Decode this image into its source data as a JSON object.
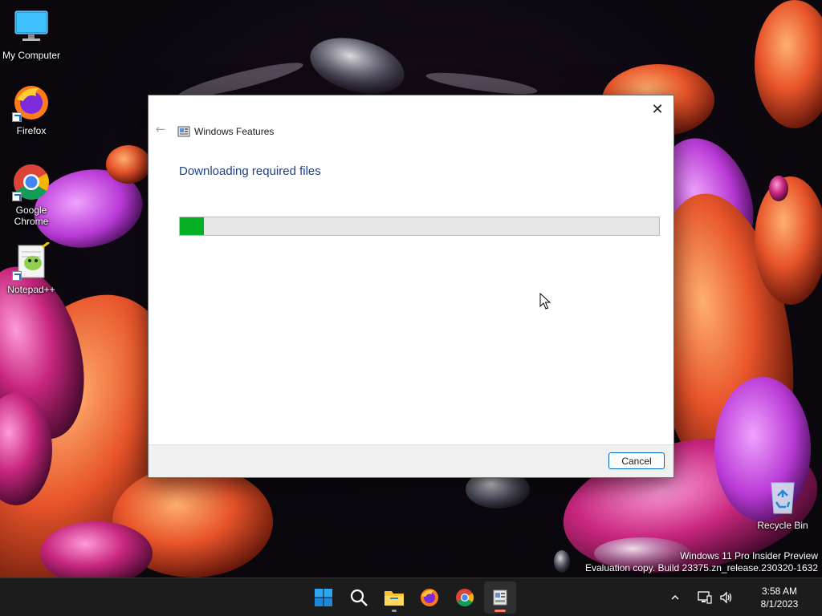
{
  "desktop": {
    "icons": [
      {
        "label": "My Computer",
        "icon": "monitor-icon"
      },
      {
        "label": "Firefox",
        "icon": "firefox-icon"
      },
      {
        "label": "Google Chrome",
        "icon": "chrome-icon"
      },
      {
        "label": "Notepad++",
        "icon": "notepadpp-icon"
      },
      {
        "label": "Recycle Bin",
        "icon": "recycle-bin-icon"
      }
    ],
    "watermark": {
      "line1": "Windows 11 Pro Insider Preview",
      "line2": "Evaluation copy. Build 23375.zn_release.230320-1632"
    }
  },
  "dialog": {
    "title": "Windows Features",
    "heading": "Downloading required files",
    "progress_percent": 5,
    "cancel_label": "Cancel",
    "close_glyph": "✕",
    "back_glyph": "←"
  },
  "taskbar": {
    "apps": [
      "start-icon",
      "search-icon",
      "file-explorer-icon",
      "firefox-icon",
      "chrome-icon",
      "windows-features-icon"
    ],
    "tray": {
      "chevron": "^",
      "time": "3:58 AM",
      "date": "8/1/2023"
    }
  },
  "colors": {
    "accent": "#0067c0",
    "heading": "#1e3f8a",
    "progress": "#06b025"
  }
}
